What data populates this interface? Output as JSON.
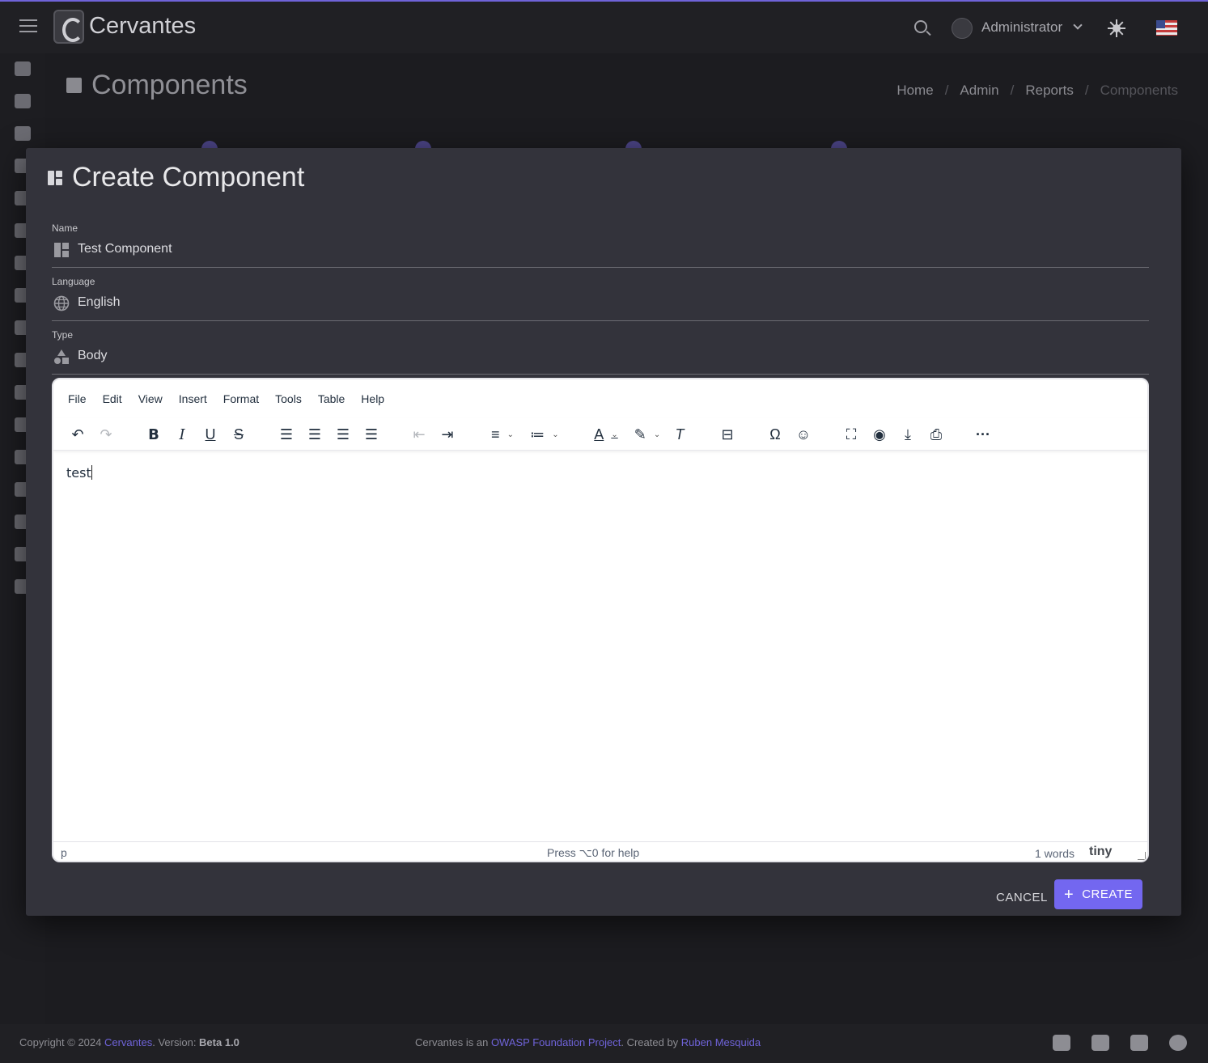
{
  "app": {
    "brand": "Cervantes",
    "user": "Administrator"
  },
  "page": {
    "title": "Components",
    "breadcrumb": [
      "Home",
      "Admin",
      "Reports",
      "Components"
    ]
  },
  "modal": {
    "title": "Create Component",
    "fields": {
      "name": {
        "label": "Name",
        "value": "Test Component"
      },
      "language": {
        "label": "Language",
        "value": "English"
      },
      "type": {
        "label": "Type",
        "value": "Body"
      }
    },
    "editor": {
      "menu": [
        "File",
        "Edit",
        "View",
        "Insert",
        "Format",
        "Tools",
        "Table",
        "Help"
      ],
      "content": "test",
      "status_path": "p",
      "status_help": "Press ⌥0 for help",
      "word_count": "1 words",
      "brand": "tiny"
    },
    "buttons": {
      "cancel": "CANCEL",
      "create": "CREATE"
    }
  },
  "footer": {
    "copyright": "Copyright © 2024 ",
    "brand_link": "Cervantes",
    "version_prefix": ". Version: ",
    "version": "Beta 1.0",
    "owasp_prefix": "Cervantes is an ",
    "owasp_link": "OWASP Foundation Project",
    "created_by": ". Created by ",
    "author_link": "Ruben Mesquida"
  },
  "colors": {
    "accent": "#7367f0",
    "background": "#1c1c20",
    "modal": "#33333b"
  }
}
